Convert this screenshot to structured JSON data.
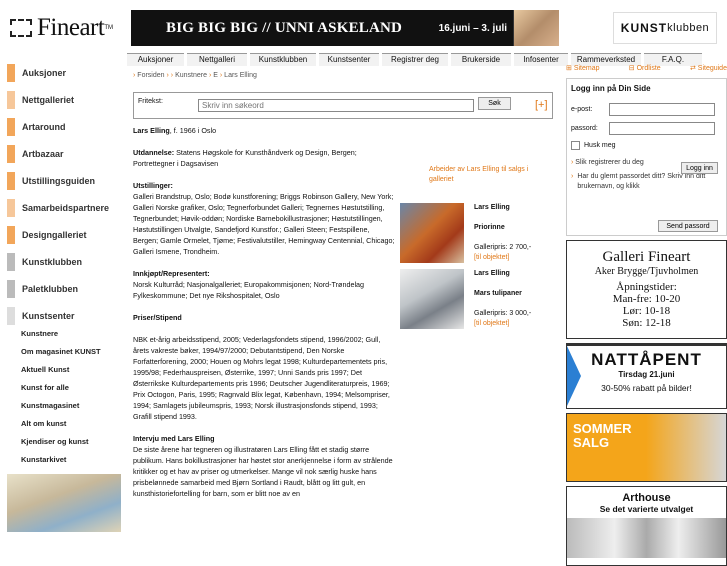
{
  "logo": {
    "text": "Fineart",
    "tm": "TM"
  },
  "banner": {
    "title": "BIG BIG BIG // UNNI ASKELAND",
    "date": "16.juni – 3. juli"
  },
  "kunstklubben_logo": {
    "bold": "KUNST",
    "light": "klubben"
  },
  "topnav": [
    "Auksjoner",
    "Nettgalleri",
    "Kunstklubben",
    "Kunstsenter",
    "Registrer deg",
    "Brukerside",
    "Infosenter",
    "Rammeverksted",
    "F.A.Q."
  ],
  "breadcrumb": [
    "Forsiden",
    "Kunstnere",
    "E",
    "Lars Elling"
  ],
  "search": {
    "label": "Fritekst:",
    "placeholder": "Skriv inn søkeord",
    "button": "Søk",
    "plus": "[+]"
  },
  "sidebar": {
    "sections": [
      {
        "label": "Auksjoner",
        "color": "#f2a65a"
      },
      {
        "label": "Nettgalleriet",
        "color": "#f6c79a"
      },
      {
        "label": "Artaround",
        "color": "#f2a65a"
      },
      {
        "label": "Artbazaar",
        "color": "#f2a65a"
      },
      {
        "label": "Utstillingsguiden",
        "color": "#f2a65a"
      },
      {
        "label": "Samarbeidspartnere",
        "color": "#f6c79a"
      },
      {
        "label": "Designgalleriet",
        "color": "#f2a65a"
      },
      {
        "label": "Kunstklubben",
        "color": "#bbbbbb"
      },
      {
        "label": "Paletklubben",
        "color": "#bbbbbb"
      },
      {
        "label": "Kunstsenter",
        "color": "#dddddd"
      }
    ],
    "sublinks": [
      "Kunstnere",
      "Om magasinet KUNST",
      "Aktuell Kunst",
      "Kunst for alle",
      "Kunstmagasinet",
      "Alt om kunst",
      "Kjendiser og kunst",
      "Kunstarkivet"
    ]
  },
  "right": {
    "sitemap": "Sitemap",
    "ordliste": "Ordliste",
    "sitegaide": "Siteguide",
    "login": {
      "title": "Logg inn på Din Side",
      "email_label": "e-post:",
      "password_label": "passord:",
      "remember": "Husk meg",
      "login_button": "Logg inn",
      "register_link": "Slik registrerer du deg",
      "forgot_text": "Har du glemt passordet ditt? Skriv inn ditt brukernavn, og klikk",
      "send_button": "Send passord"
    },
    "ad1": {
      "title": "Galleri Fineart",
      "sub": "Aker Brygge/Tjuvholmen",
      "h1": "Åpningstider:",
      "h2": "Man-fre: 10-20",
      "h3": "Lør: 10-18",
      "h4": "Søn: 12-18"
    },
    "ad2": {
      "title": "NATTÅPENT",
      "sub": "Tirsdag 21.juni",
      "offer": "30-50% rabatt på bilder!"
    },
    "ad3": {
      "l1": "SOMMER",
      "l2": "SALG"
    },
    "ad4": {
      "title": "Arthouse",
      "sub": "Se det varierte utvalget"
    }
  },
  "content": {
    "name": "Lars Elling",
    "born": ", f. 1966 i Oslo",
    "education_h": "Utdannelse:",
    "education": " Statens Høgskole for Kunsthåndverk og Design, Bergen; Portrettegner i Dagsavisen",
    "exhibitions_h": "Utstillinger:",
    "exhibitions": "Galleri Brandstrup, Oslo; Bodø kunstforening; Briggs Robinson Gallery, New York; Galleri Norske grafiker, Oslo; Tegnerforbundet Galleri; Tegnernes Høstutstilling, Tegnerbundet; Høvik-oddøn; Nordiske Barnebokillustrasjoner; Høstutstillingen, Høstutstillingen Utvalgte, Sandefjord Kunstfor.; Galleri Steen; Festspillene, Bergen; Gamle Ormelet, Tjøme; Festivalutstiller, Hemingway Centennial, Chicago; Galleri Ismene, Trondheim.",
    "purchases_h": "Innkjøpt/Representert:",
    "purchases": "Norsk Kulturråd; Nasjonalgalleriet; Europakommisjonen; Nord-Trøndelag Fylkeskommune; Det nye Rikshospitalet, Oslo",
    "prizes_h": "Priser/Stipend",
    "prizes": "NBK et-årig arbeidsstipend, 2005; Vederlagsfondets stipend, 1996/2002; Gull, årets vakreste bøker, 1994/97/2000; Debutantstipend, Den Norske Forfatterforening, 2000; Houen og Mohrs legat 1998; Kulturdepartementets pris, 1995/98; Federhauspreisen, Østerrike, 1997; Unni Sands pris 1997; Det Østerrikske Kulturdepartements pris 1996; Deutscher Jugendliteraturpreis, 1969; Prix Octogon, Paris, 1995; Ragnvald Blix legat, København, 1994; Melsompriser, 1994; Samlagets jubileumspris, 1993; Norsk illustrasjonsfonds stipend, 1993; Grafill stipend 1993.",
    "interview_h": "Intervju med Lars Elling",
    "interview": "De siste årene har tegneren og illustratøren Lars Elling fått et stadig større publikum. Hans bokillustrasjoner har høstet stor anerkjennelse i form av strålende kritikker og et hav av priser og utmerkelser. Mange vil nok særlig huske hans prisbelønnede samarbeid med Bjørn Sortland i Raudt, blått og litt gult, en kunsthistoriefortelling for barn, som er blitt noe av en"
  },
  "middle": {
    "arbeider": "Arbeider av Lars Elling til salgs i galleriet",
    "works": [
      {
        "artist": "Lars Elling",
        "title": "Priorinne",
        "price": "Galleripris: 2 700,-",
        "link": "[til objektet]"
      },
      {
        "artist": "Lars Elling",
        "title": "Mars tulipaner",
        "price": "Galleripris: 3 000,-",
        "link": "[til objektet]"
      }
    ]
  }
}
